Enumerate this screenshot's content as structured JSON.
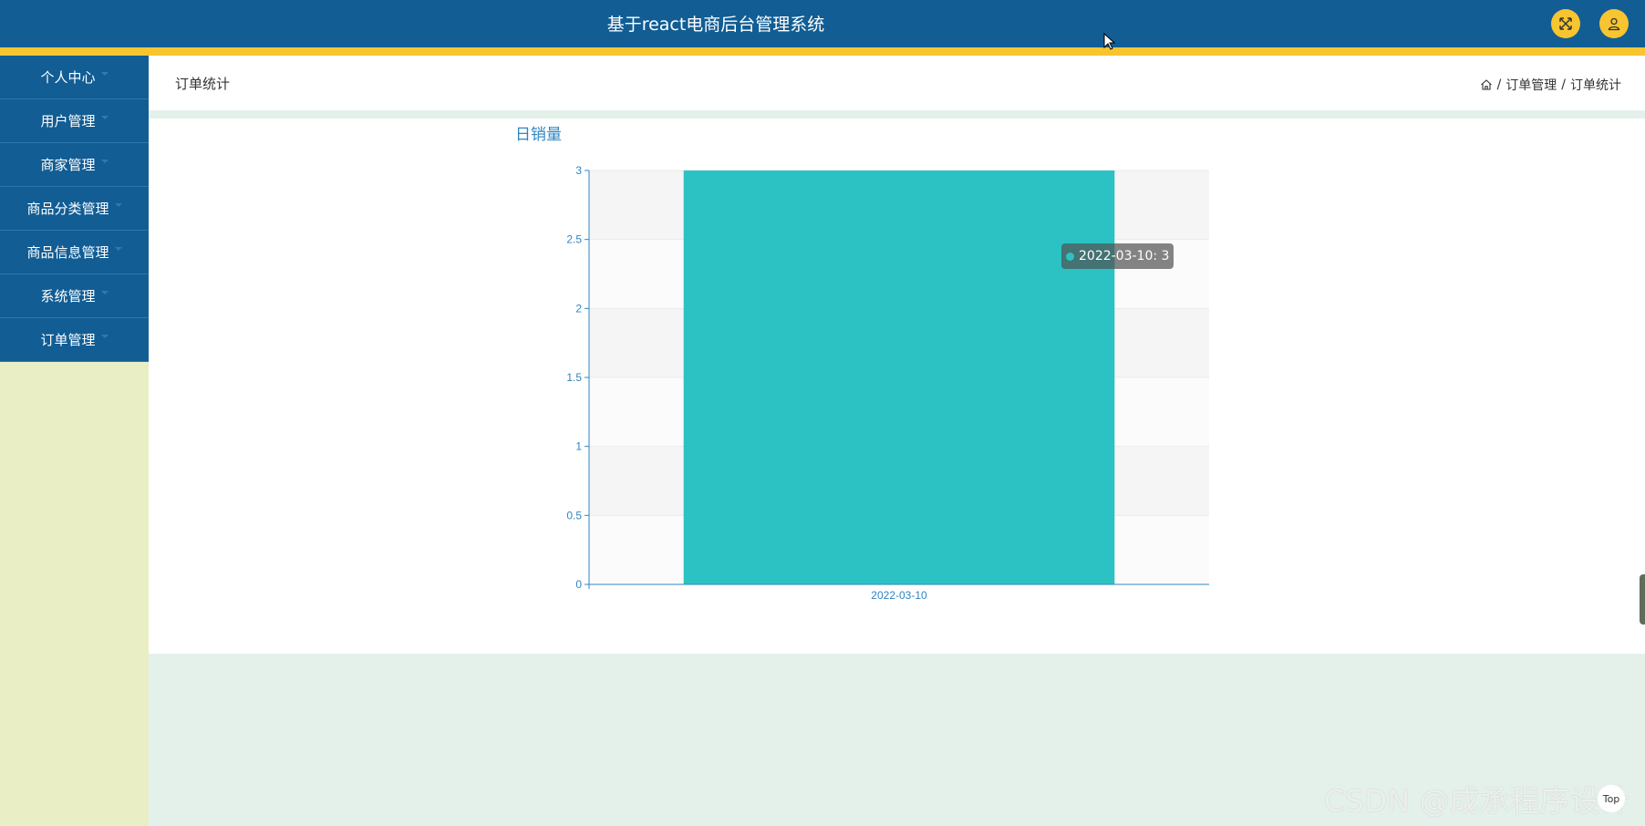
{
  "header": {
    "title": "基于react电商后台管理系统",
    "fullscreen_icon": "fullscreen-icon",
    "user_icon": "user-icon",
    "colors": {
      "bar": "#115d94",
      "accent": "#f6c530"
    }
  },
  "sidebar": {
    "items": [
      {
        "label": "个人中心"
      },
      {
        "label": "用户管理"
      },
      {
        "label": "商家管理"
      },
      {
        "label": "商品分类管理"
      },
      {
        "label": "商品信息管理"
      },
      {
        "label": "系统管理"
      },
      {
        "label": "订单管理"
      }
    ]
  },
  "page": {
    "title": "订单统计",
    "breadcrumb": {
      "home_icon": "home-icon",
      "sep": "/",
      "parent": "订单管理",
      "current": "订单统计"
    }
  },
  "chart_data": {
    "type": "bar",
    "title": "日销量",
    "categories": [
      "2022-03-10"
    ],
    "values": [
      3
    ],
    "ylim": [
      0,
      3
    ],
    "yticks": [
      "0",
      "0.5",
      "1",
      "1.5",
      "2",
      "2.5",
      "3"
    ],
    "xlabel": "",
    "ylabel": "",
    "grid": true,
    "bar_color": "#2cc2c4",
    "axis_color": "#2f85c1",
    "tooltip": "2022-03-10: 3"
  },
  "footer": {
    "watermark": "CSDN @成承程序设计",
    "top_label": "Top"
  }
}
